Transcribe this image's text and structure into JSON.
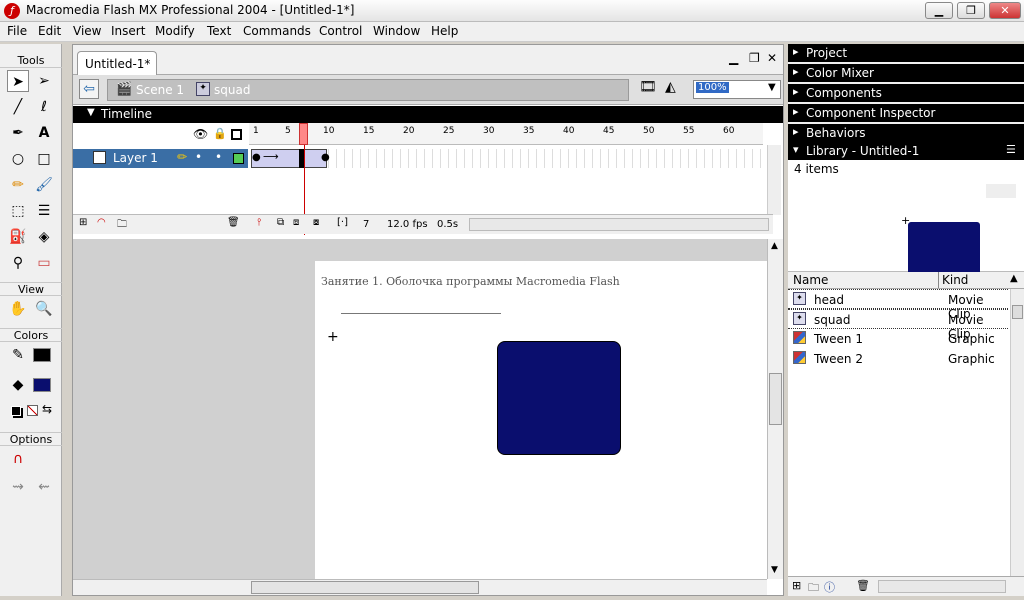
{
  "window": {
    "title": "Macromedia Flash MX Professional 2004 - [Untitled-1*]"
  },
  "menu": [
    "File",
    "Edit",
    "View",
    "Insert",
    "Modify",
    "Text",
    "Commands",
    "Control",
    "Window",
    "Help"
  ],
  "tools": {
    "header": "Tools",
    "view_label": "View",
    "colors_label": "Colors",
    "options_label": "Options"
  },
  "document": {
    "tab": "Untitled-1*",
    "crumbs": {
      "scene": "Scene 1",
      "symbol": "squad"
    },
    "zoom": "100%"
  },
  "timeline": {
    "header": "Timeline",
    "ruler": [
      "1",
      "5",
      "10",
      "15",
      "20",
      "25",
      "30",
      "35",
      "40",
      "45",
      "50",
      "55",
      "60"
    ],
    "layer_name": "Layer 1",
    "current_frame": "7",
    "fps": "12.0 fps",
    "elapsed": "0.5s"
  },
  "stage": {
    "heading_text": "Занятие 1. Оболочка программы Macromedia Flash",
    "shape_color": "#0a0e6e"
  },
  "panels": {
    "project": "Project",
    "color_mixer": "Color Mixer",
    "components": "Components",
    "component_inspector": "Component Inspector",
    "behaviors": "Behaviors",
    "library": "Library - Untitled-1"
  },
  "library": {
    "count": "4 items",
    "col_name": "Name",
    "col_kind": "Kind",
    "items": [
      {
        "name": "head",
        "kind": "Movie Clip"
      },
      {
        "name": "squad",
        "kind": "Movie Clip"
      },
      {
        "name": "Tween 1",
        "kind": "Graphic"
      },
      {
        "name": "Tween 2",
        "kind": "Graphic"
      }
    ]
  }
}
